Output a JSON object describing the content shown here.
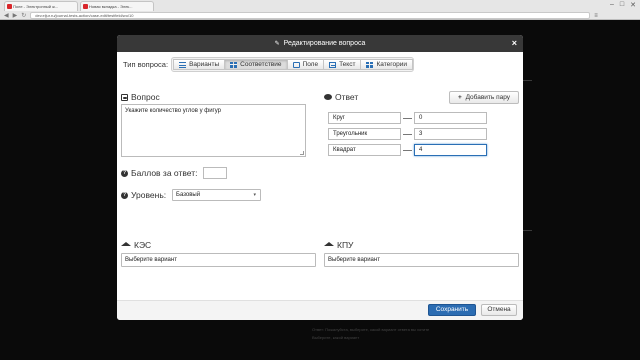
{
  "browser": {
    "tabs": [
      {
        "title": "Поле - Электронный ж..."
      },
      {
        "title": "Новая вкладка - Элек..."
      }
    ],
    "url": "dev.eljur.ru/journal-tests-action/case-edit/testfield/wo/10",
    "back_glyph": "◀",
    "forward_glyph": "▶",
    "reload_glyph": "↻",
    "menu_glyph": "≡",
    "min_glyph": "–",
    "max_glyph": "□",
    "close_glyph": "✕"
  },
  "background": {
    "text_line1": "Ответ: Пожалуйста, выберите, какой вариант ответа вы хотите",
    "text_line2": "Выберите, какой вариант"
  },
  "modal": {
    "title": "Редактирование вопроса",
    "pencil_glyph": "✎",
    "close_glyph": "×",
    "question_type_label": "Тип вопроса:",
    "question_types": [
      {
        "label": "Варианты",
        "icon": "list-icon",
        "active": false
      },
      {
        "label": "Соответствие",
        "icon": "grid-icon",
        "active": true
      },
      {
        "label": "Поле",
        "icon": "field-icon",
        "active": false
      },
      {
        "label": "Текст",
        "icon": "text-icon",
        "active": false
      },
      {
        "label": "Категории",
        "icon": "grid-icon",
        "active": false
      }
    ],
    "question_label": "Вопрос",
    "question_text": "Укажите количество углов у фигур",
    "answer_label": "Ответ",
    "add_pair_label": "Добавить пару",
    "add_pair_plus": "+",
    "pairs": [
      {
        "left": "Круг",
        "right": "0"
      },
      {
        "left": "Треугольник",
        "right": "3"
      },
      {
        "left": "Квадрат",
        "right": "4"
      }
    ],
    "score_label": "Баллов за ответ:",
    "score_value": "",
    "level_label": "Уровень:",
    "level_value": "Базовый",
    "kes_label": "КЭС",
    "kes_placeholder": "Выберите вариант",
    "kpu_label": "КПУ",
    "kpu_placeholder": "Выберите вариант",
    "save_label": "Сохранить",
    "cancel_label": "Отмена",
    "question_glyph": "?",
    "caret_glyph": "▾",
    "accent_color": "#2b6cb2"
  }
}
